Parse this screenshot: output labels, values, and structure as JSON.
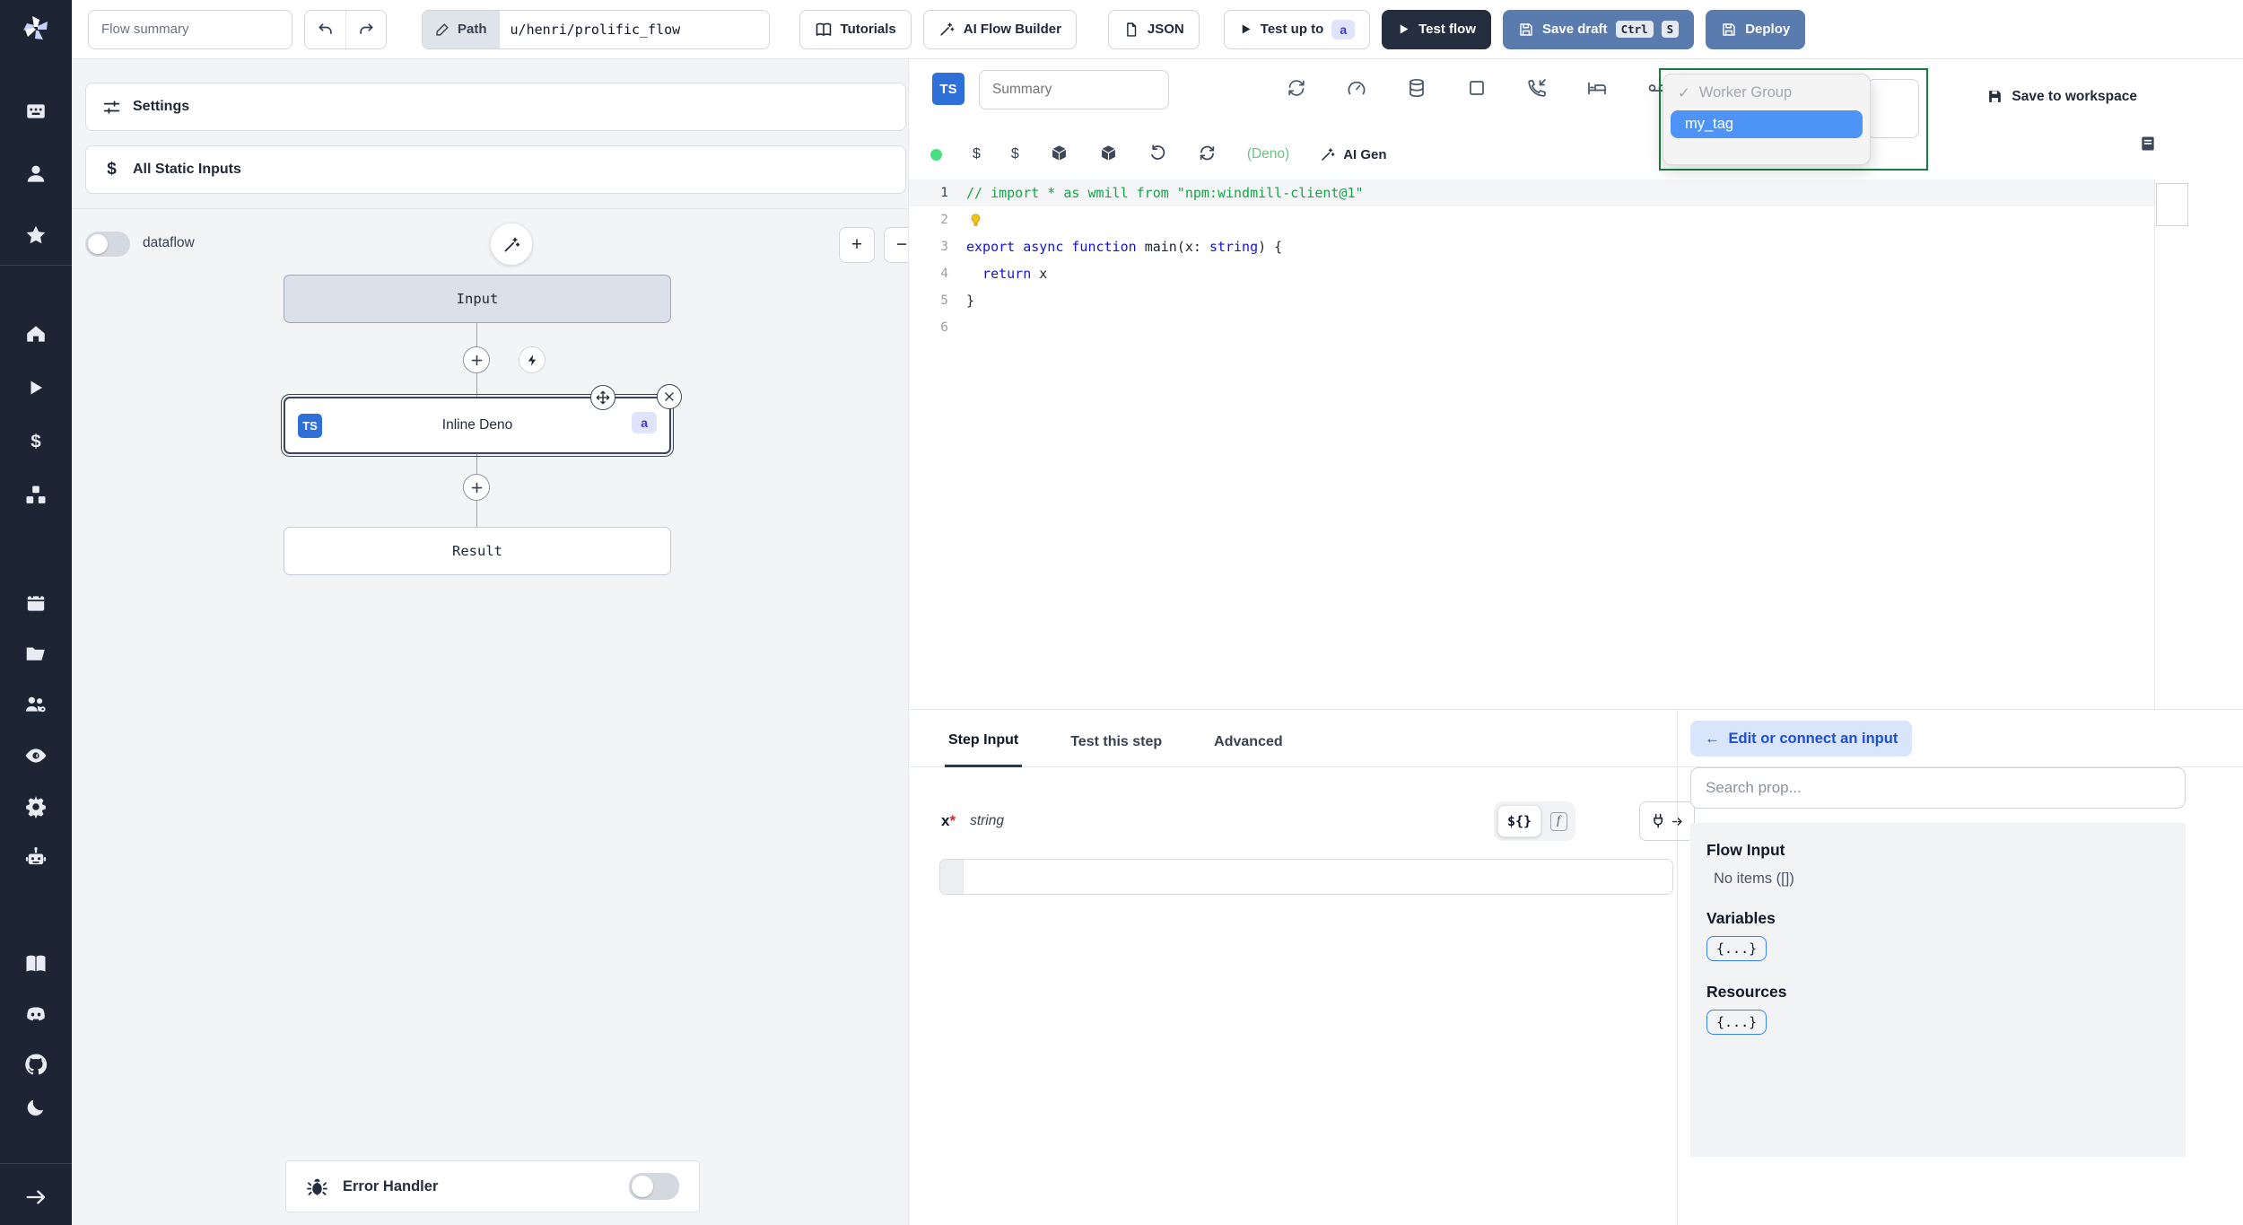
{
  "topbar": {
    "flow_summary_placeholder": "Flow summary",
    "path_label": "Path",
    "path_value": "u/henri/prolific_flow",
    "tutorials_label": "Tutorials",
    "ai_flow_builder_label": "AI Flow Builder",
    "json_label": "JSON",
    "test_up_to_label": "Test up to",
    "test_up_to_badge": "a",
    "test_flow_label": "Test flow",
    "save_draft_label": "Save draft",
    "kbd_ctrl": "Ctrl",
    "kbd_s": "S",
    "deploy_label": "Deploy"
  },
  "sidebar_icons": [
    "windmill-logo",
    "apps",
    "user",
    "star",
    "home",
    "runs",
    "variables",
    "resources",
    "schedules",
    "folders",
    "workers",
    "audit-logs",
    "settings",
    "ai-assistant",
    "docs",
    "discord",
    "github",
    "dark-mode",
    "expand-sidebar"
  ],
  "flow_panel": {
    "settings_label": "Settings",
    "all_static_inputs_label": "All Static Inputs",
    "dataflow_label": "dataflow",
    "graph": {
      "input_node": "Input",
      "step_node": "Inline Deno",
      "step_lang_badge": "TS",
      "step_id_badge": "a",
      "result_node": "Result"
    },
    "error_handler_label": "Error Handler"
  },
  "editor": {
    "lang_badge": "TS",
    "summary_placeholder": "Summary",
    "runtime_label": "(Deno)",
    "ai_gen_label": "AI Gen",
    "save_to_workspace_label": "Save to workspace",
    "tag_dropdown": {
      "check": "✓",
      "group_label": "Worker Group",
      "selected_option": "my_tag"
    },
    "code": {
      "lines": [
        {
          "num": "1",
          "active": true,
          "tokens": [
            {
              "t": "// import * as wmill from \"npm:windmill-client@1\"",
              "c": "comment"
            }
          ]
        },
        {
          "num": "2",
          "bulb": true,
          "tokens": []
        },
        {
          "num": "3",
          "tokens": [
            {
              "t": "export async function ",
              "c": "kw"
            },
            {
              "t": "main",
              "c": "plain"
            },
            {
              "t": "(x",
              "c": "plain"
            },
            {
              "t": ": ",
              "c": "plain"
            },
            {
              "t": "string",
              "c": "kw"
            },
            {
              "t": ") {",
              "c": "plain"
            }
          ]
        },
        {
          "num": "4",
          "tokens": [
            {
              "t": "  return",
              "c": "kw"
            },
            {
              "t": " x",
              "c": "plain"
            }
          ]
        },
        {
          "num": "5",
          "tokens": [
            {
              "t": "}",
              "c": "plain"
            }
          ]
        },
        {
          "num": "6",
          "tokens": []
        }
      ]
    }
  },
  "bottom_panel": {
    "tabs": [
      {
        "label": "Step Input",
        "active": true
      },
      {
        "label": "Test this step",
        "active": false
      },
      {
        "label": "Advanced",
        "active": false
      }
    ],
    "field": {
      "name": "x",
      "required_marker": "*",
      "type": "string",
      "template_toggle": "${}",
      "fn_toggle": "f"
    },
    "connect_panel": {
      "back_arrow": "←",
      "edit_button_label": "Edit or connect an input",
      "search_placeholder": "Search prop...",
      "flow_input_title": "Flow Input",
      "flow_input_empty": "No items ([])",
      "variables_title": "Variables",
      "variables_chip": "{...}",
      "resources_title": "Resources",
      "resources_chip": "{...}"
    }
  },
  "colors": {
    "accent_blue": "#4d94f6",
    "brand_dark": "#252e3f",
    "muted_blue_button": "#5a7bae",
    "badge_lavender_bg": "#e0e3fc",
    "badge_indigo_text": "#4338ca",
    "success_green": "#4ade80",
    "dropdown_border_green": "#15803d",
    "ts_badge_blue": "#2e6fd8"
  }
}
